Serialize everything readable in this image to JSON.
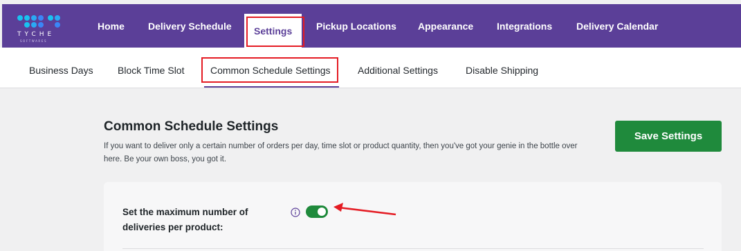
{
  "colors": {
    "brand": "#5b3f98",
    "highlight": "#e41b23",
    "save_button": "#1f8a3c",
    "toggle_on": "#1f8a3c"
  },
  "logo": {
    "name": "TYCHE",
    "subtitle": "SOFTWARES"
  },
  "nav": {
    "items": [
      {
        "label": "Home"
      },
      {
        "label": "Delivery Schedule"
      },
      {
        "label": "Settings",
        "active": true
      },
      {
        "label": "Pickup Locations"
      },
      {
        "label": "Appearance"
      },
      {
        "label": "Integrations"
      },
      {
        "label": "Delivery Calendar"
      }
    ]
  },
  "subnav": {
    "items": [
      {
        "label": "Business Days"
      },
      {
        "label": "Block Time Slot"
      },
      {
        "label": "Common Schedule Settings",
        "active": true
      },
      {
        "label": "Additional Settings"
      },
      {
        "label": "Disable Shipping"
      }
    ]
  },
  "main": {
    "title": "Common Schedule Settings",
    "description": "If you want to deliver only a certain number of orders per day, time slot or product quantity, then you've got your genie in the bottle over here. Be your own boss, you got it.",
    "save_label": "Save Settings"
  },
  "settings": {
    "max_deliveries_label": "Set the maximum number of deliveries per product:",
    "max_deliveries_enabled": true,
    "info_icon": "info-icon"
  }
}
